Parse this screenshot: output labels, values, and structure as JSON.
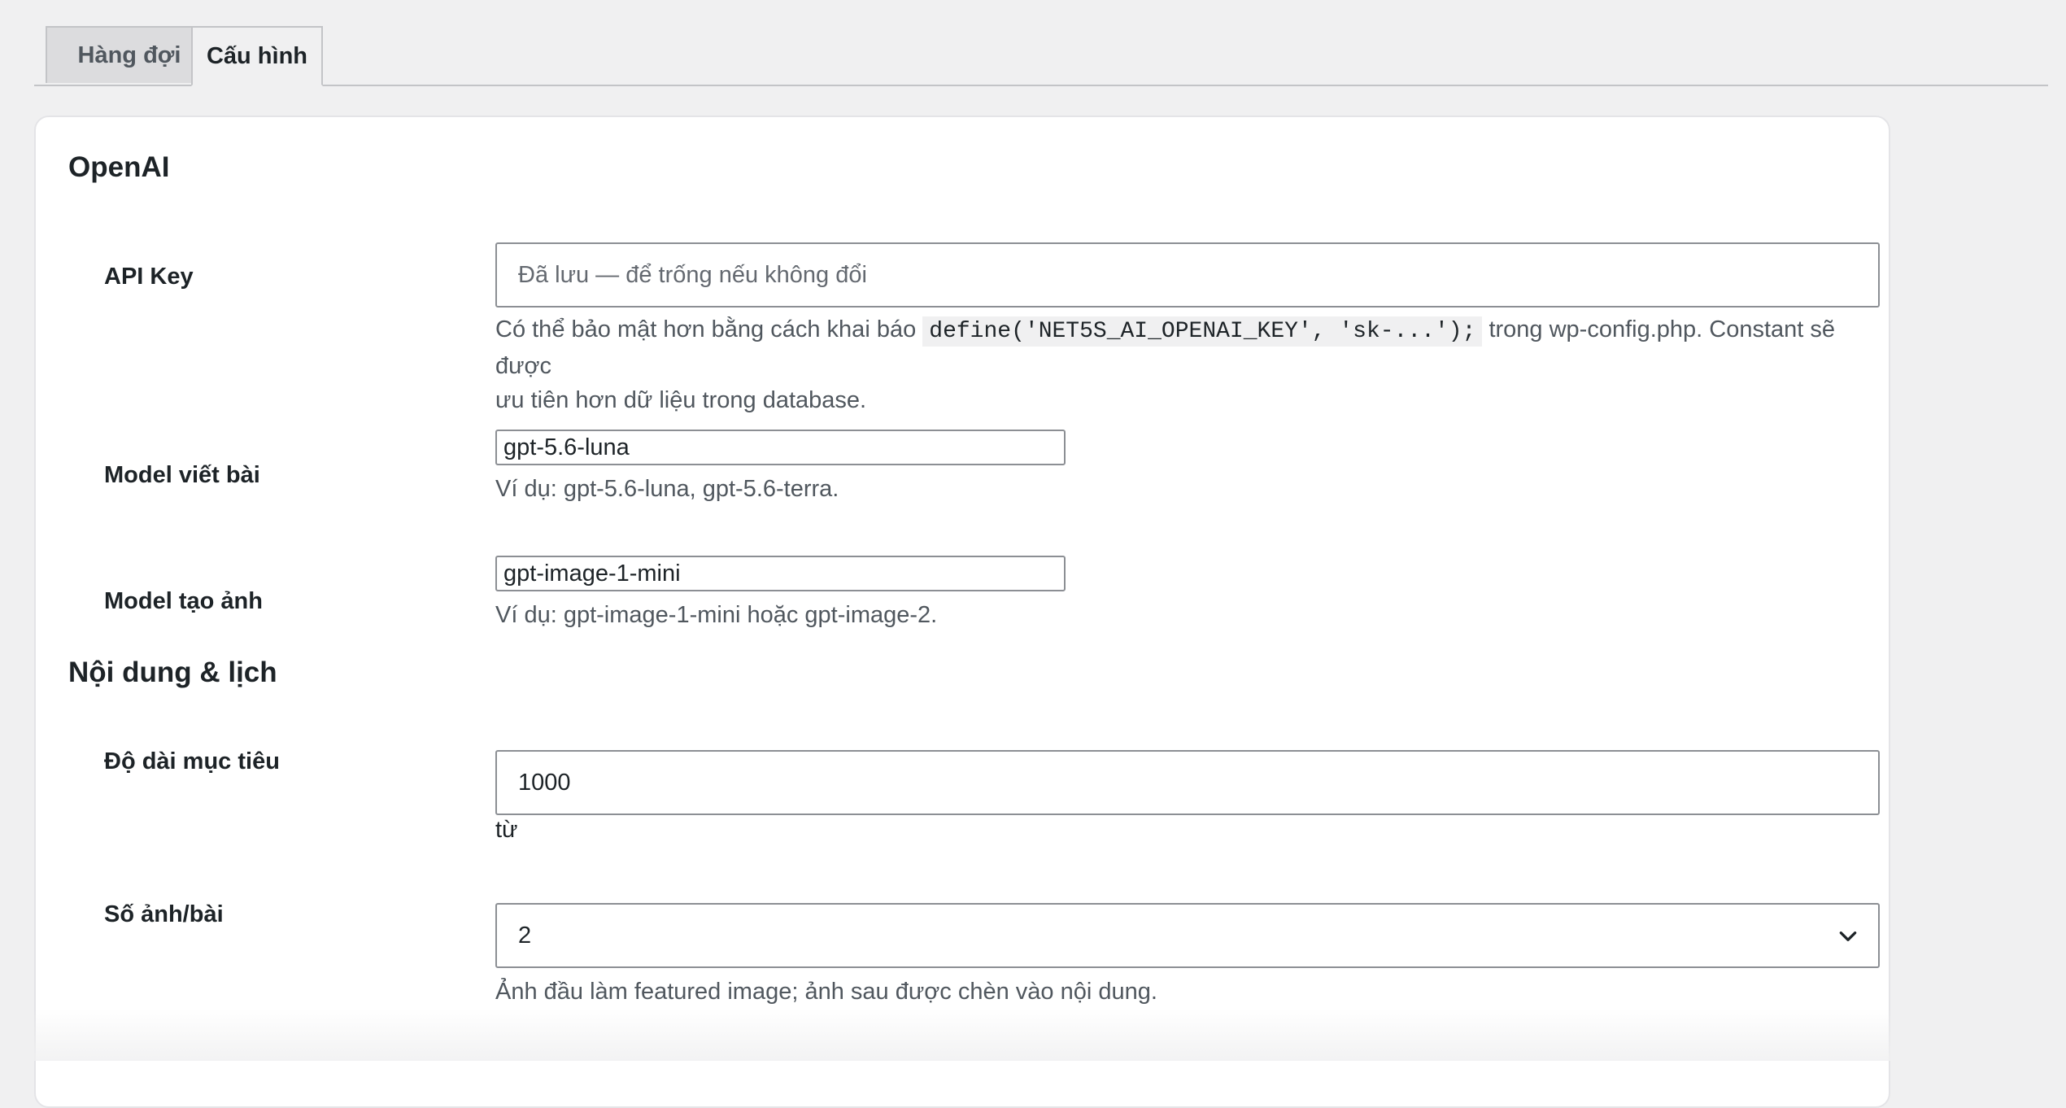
{
  "tabs": {
    "queue": "Hàng đợi",
    "config": "Cấu hình"
  },
  "openai": {
    "heading": "OpenAI",
    "api_key": {
      "label": "API Key",
      "placeholder": "Đã lưu — để trống nếu không đổi",
      "value": "",
      "desc_before": "Có thể bảo mật hơn bằng cách khai báo",
      "desc_code": "define('NET5S_AI_OPENAI_KEY', 'sk-...');",
      "desc_after": "trong wp-config.php. Constant sẽ được",
      "desc_line2": "ưu tiên hơn dữ liệu trong database."
    },
    "model_write": {
      "label": "Model viết bài",
      "value": "gpt-5.6-luna",
      "desc": "Ví dụ: gpt-5.6-luna, gpt-5.6-terra."
    },
    "model_image": {
      "label": "Model tạo ảnh",
      "value": "gpt-image-1-mini",
      "desc": "Ví dụ: gpt-image-1-mini hoặc gpt-image-2."
    }
  },
  "content": {
    "heading": "Nội dung & lịch",
    "target_length": {
      "label": "Độ dài mục tiêu",
      "value": "1000",
      "unit": "từ"
    },
    "images_per_post": {
      "label": "Số ảnh/bài",
      "value": "2",
      "desc": "Ảnh đầu làm featured image; ảnh sau được chèn vào nội dung."
    }
  },
  "icons": {
    "select_arrow": "chevron-down-icon"
  }
}
